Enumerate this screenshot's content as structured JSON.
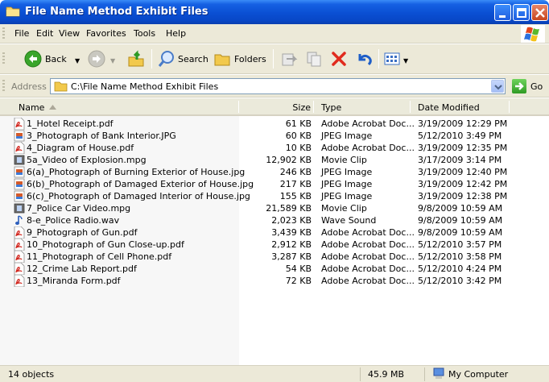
{
  "window": {
    "title": "File Name Method Exhibit Files"
  },
  "menu": [
    "File",
    "Edit",
    "View",
    "Favorites",
    "Tools",
    "Help"
  ],
  "toolbar": {
    "back_label": "Back",
    "search_label": "Search",
    "folders_label": "Folders"
  },
  "address": {
    "label": "Address",
    "value": "C:\\File Name Method Exhibit Files",
    "go_label": "Go"
  },
  "columns": {
    "name": "Name",
    "size": "Size",
    "type": "Type",
    "date": "Date Modified"
  },
  "files": [
    {
      "name": "1_Hotel Receipt.pdf",
      "size": "61 KB",
      "type": "Adobe Acrobat Doc...",
      "date": "3/19/2009 12:29 PM",
      "icon": "pdf-icon"
    },
    {
      "name": "3_Photograph of Bank Interior.JPG",
      "size": "60 KB",
      "type": "JPEG Image",
      "date": "5/12/2010 3:49 PM",
      "icon": "jpeg-icon"
    },
    {
      "name": "4_Diagram of House.pdf",
      "size": "10 KB",
      "type": "Adobe Acrobat Doc...",
      "date": "3/19/2009 12:35 PM",
      "icon": "pdf-icon"
    },
    {
      "name": "5a_Video of Explosion.mpg",
      "size": "12,902 KB",
      "type": "Movie Clip",
      "date": "3/17/2009 3:14 PM",
      "icon": "movie-icon"
    },
    {
      "name": "6(a)_Photograph of Burning Exterior of House.jpg",
      "size": "246 KB",
      "type": "JPEG Image",
      "date": "3/19/2009 12:40 PM",
      "icon": "jpeg-icon"
    },
    {
      "name": "6(b)_Photograph of Damaged Exterior of House.jpg",
      "size": "217 KB",
      "type": "JPEG Image",
      "date": "3/19/2009 12:42 PM",
      "icon": "jpeg-icon"
    },
    {
      "name": "6(c)_Photograph of Damaged Interior of House.jpg",
      "size": "155 KB",
      "type": "JPEG Image",
      "date": "3/19/2009 12:38 PM",
      "icon": "jpeg-icon"
    },
    {
      "name": "7_Police Car Video.mpg",
      "size": "21,589 KB",
      "type": "Movie Clip",
      "date": "9/8/2009 10:59 AM",
      "icon": "movie-icon"
    },
    {
      "name": "8-e_Police Radio.wav",
      "size": "2,023 KB",
      "type": "Wave Sound",
      "date": "9/8/2009 10:59 AM",
      "icon": "audio-icon"
    },
    {
      "name": "9_Photograph of Gun.pdf",
      "size": "3,439 KB",
      "type": "Adobe Acrobat Doc...",
      "date": "9/8/2009 10:59 AM",
      "icon": "pdf-icon"
    },
    {
      "name": "10_Photograph of Gun Close-up.pdf",
      "size": "2,912 KB",
      "type": "Adobe Acrobat Doc...",
      "date": "5/12/2010 3:57 PM",
      "icon": "pdf-icon"
    },
    {
      "name": "11_Photograph of Cell Phone.pdf",
      "size": "3,287 KB",
      "type": "Adobe Acrobat Doc...",
      "date": "5/12/2010 3:58 PM",
      "icon": "pdf-icon"
    },
    {
      "name": "12_Crime Lab Report.pdf",
      "size": "54 KB",
      "type": "Adobe Acrobat Doc...",
      "date": "5/12/2010 4:24 PM",
      "icon": "pdf-icon"
    },
    {
      "name": "13_Miranda Form.pdf",
      "size": "72 KB",
      "type": "Adobe Acrobat Doc...",
      "date": "5/12/2010 3:42 PM",
      "icon": "pdf-icon"
    }
  ],
  "status": {
    "count": "14 objects",
    "total_size": "45.9 MB",
    "location": "My Computer"
  },
  "colors": {
    "titlebar": "#0a4fd3",
    "chrome": "#ece9d8",
    "delete_red": "#e02b1e"
  }
}
